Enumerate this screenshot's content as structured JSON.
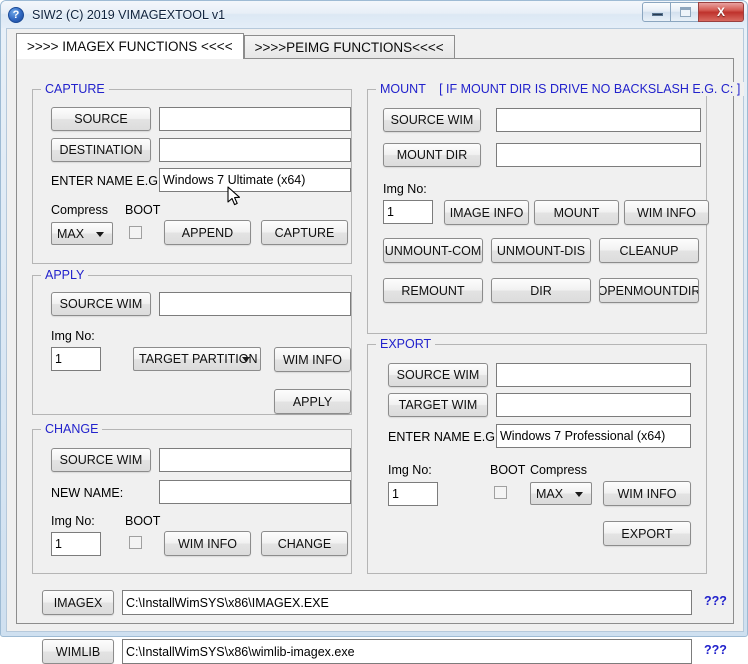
{
  "window": {
    "title": "SIW2 (C) 2019 VIMAGEXTOOL v1",
    "icon": "help-circle-icon",
    "minimize_label": "",
    "maximize_label": "",
    "close_label": "X"
  },
  "tabs": [
    {
      "label": ">>>> IMAGEX FUNCTIONS <<<<",
      "active": true
    },
    {
      "label": ">>>>PEIMG FUNCTIONS<<<<",
      "active": false
    }
  ],
  "capture": {
    "title": "CAPTURE",
    "source_button": "SOURCE",
    "source_value": "",
    "destination_button": "DESTINATION",
    "destination_value": "",
    "name_label": "ENTER NAME E.G.:",
    "name_value": "Windows 7 Ultimate (x64)",
    "compress_label": "Compress",
    "compress_value": "MAX",
    "boot_label": "BOOT",
    "append_button": "APPEND",
    "capture_button": "CAPTURE"
  },
  "apply": {
    "title": "APPLY",
    "source_wim_button": "SOURCE WIM",
    "source_wim_value": "",
    "img_no_label": "Img No:",
    "img_no_value": "1",
    "target_partition_value": "TARGET PARTITION",
    "wim_info_button": "WIM INFO",
    "apply_button": "APPLY"
  },
  "change": {
    "title": "CHANGE",
    "source_wim_button": "SOURCE WIM",
    "source_wim_value": "",
    "new_name_label": "NEW NAME:",
    "new_name_value": "",
    "img_no_label": "Img No:",
    "img_no_value": "1",
    "boot_label": "BOOT",
    "wim_info_button": "WIM INFO",
    "change_button": "CHANGE"
  },
  "mount": {
    "title": "MOUNT",
    "title_hint": "[ IF MOUNT DIR IS DRIVE NO BACKSLASH E.G. C: ]",
    "source_wim_button": "SOURCE WIM",
    "source_wim_value": "",
    "mount_dir_button": "MOUNT DIR",
    "mount_dir_value": "",
    "img_no_label": "Img No:",
    "img_no_value": "1",
    "image_info_button": "IMAGE INFO",
    "mount_button": "MOUNT",
    "wim_info_button": "WIM INFO",
    "unmount_com_button": "UNMOUNT-COM",
    "unmount_dis_button": "UNMOUNT-DIS",
    "cleanup_button": "CLEANUP",
    "remount_button": "REMOUNT",
    "dir_button": "DIR",
    "openmountdir_button": "OPENMOUNTDIR"
  },
  "export": {
    "title": "EXPORT",
    "source_wim_button": "SOURCE WIM",
    "source_wim_value": "",
    "target_wim_button": "TARGET WIM",
    "target_wim_value": "",
    "name_label": "ENTER NAME E.G.:",
    "name_value": "Windows 7 Professional (x64)",
    "img_no_label": "Img No:",
    "img_no_value": "1",
    "boot_label": "BOOT",
    "compress_label": "Compress",
    "compress_value": "MAX",
    "wim_info_button": "WIM INFO",
    "export_button": "EXPORT"
  },
  "paths": {
    "imagex_button": "IMAGEX",
    "imagex_value": "C:\\InstallWimSYS\\x86\\IMAGEX.EXE",
    "imagex_help": "???",
    "wimlib_button": "WIMLIB",
    "wimlib_value": "C:\\InstallWimSYS\\x86\\wimlib-imagex.exe",
    "wimlib_help": "???"
  },
  "colors": {
    "group_title": "#2222cc",
    "window_frame": "#cfe0f0",
    "client_bg": "#f0f0f0",
    "close_button": "#bf322c"
  }
}
